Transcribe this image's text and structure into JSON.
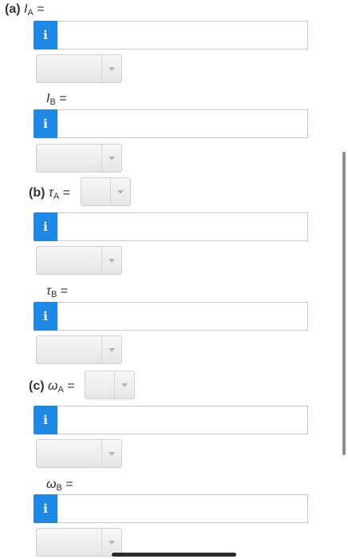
{
  "parts": {
    "a": {
      "part_label": "(a)",
      "symbol_main": "I",
      "sub_A": "A",
      "sub_B": "B",
      "equals": "="
    },
    "b": {
      "part_label": "(b)",
      "symbol_main": "τ",
      "sub_A": "A",
      "sub_B": "B",
      "equals": "="
    },
    "c": {
      "part_label": "(c)",
      "symbol_main": "ω",
      "sub_A": "A",
      "sub_B": "B",
      "equals": "="
    }
  },
  "info_button_glyph": "i",
  "answers": {
    "I_A": "",
    "I_B": "",
    "tau_A": "",
    "tau_B": "",
    "omega_A": "",
    "omega_B": ""
  },
  "units": {
    "I_A": "",
    "I_B": "",
    "tau_A_direction": "",
    "tau_A": "",
    "tau_B": "",
    "omega_A_direction": "",
    "omega_A": "",
    "omega_B": ""
  },
  "colors": {
    "info_button": "#1e88e5",
    "field_border": "#c9c9c9",
    "label_text": "#333333"
  },
  "icons": {
    "info": "info-icon",
    "dropdown": "chevron-down-icon"
  }
}
